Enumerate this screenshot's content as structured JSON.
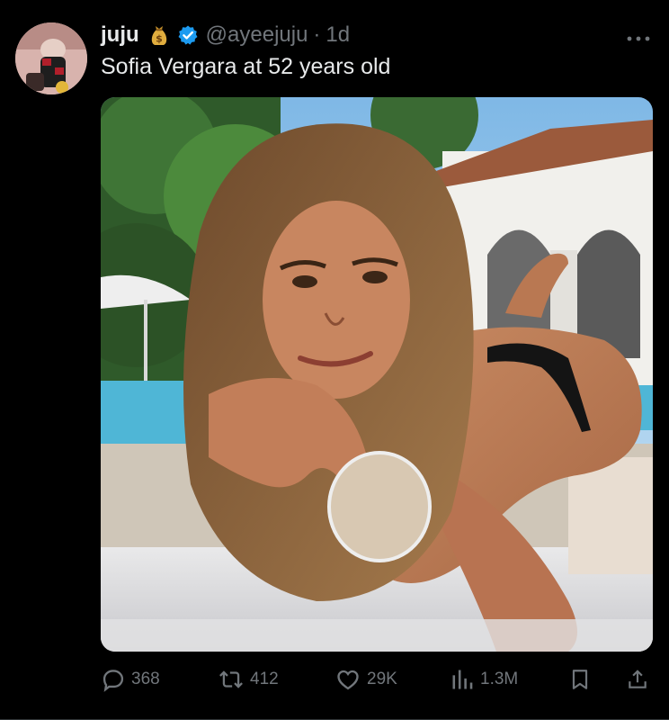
{
  "author": {
    "display_name": "juju",
    "emoji_icon": "money-bag-icon",
    "verified": true,
    "handle": "@ayeejuju",
    "separator": "·",
    "time": "1d"
  },
  "tweet": {
    "text": "Sofia Vergara at 52 years old"
  },
  "actions": {
    "replies": "368",
    "retweets": "412",
    "likes": "29K",
    "views": "1.3M"
  },
  "colors": {
    "background": "#000000",
    "text": "#e7e9ea",
    "muted": "#71767b",
    "verified_badge": "#1d9bf0"
  }
}
